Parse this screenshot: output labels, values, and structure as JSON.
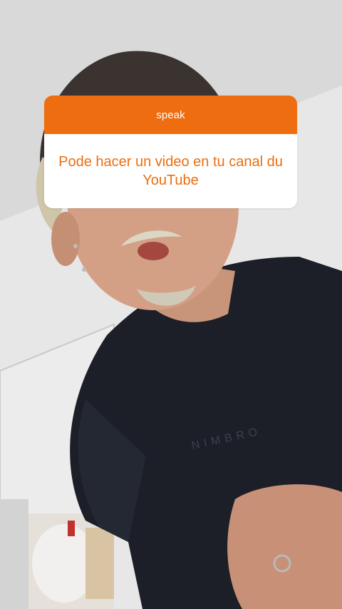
{
  "story": {
    "question_sticker": {
      "label": "speak",
      "text": "Pode hacer un video en tu canal du YouTube",
      "accent_color": "#ee6d10"
    },
    "background": {
      "description_icon": "video-frame"
    }
  }
}
